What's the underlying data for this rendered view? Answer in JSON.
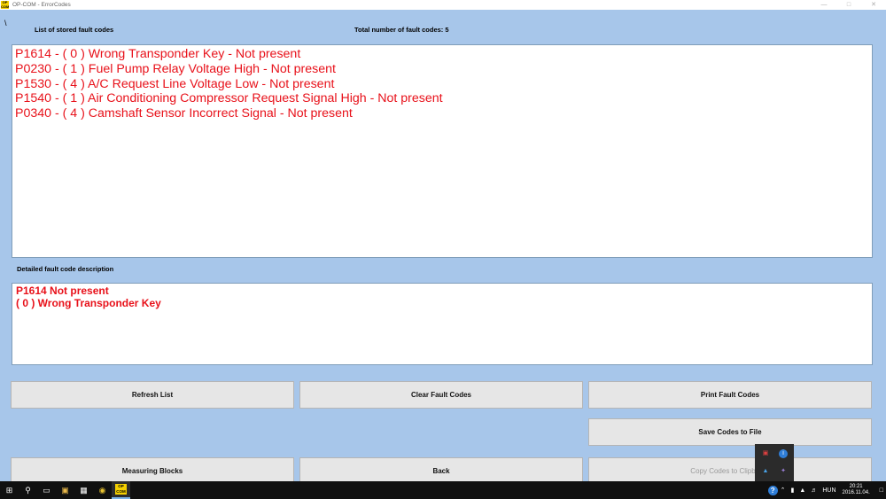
{
  "window": {
    "title": "OP-COM - ErrorCodes",
    "app_icon_text": "OP COM"
  },
  "header": {
    "backslash": "\\",
    "list_label": "List of stored fault codes",
    "total_label": "Total number of fault codes:  5"
  },
  "faults": [
    "P1614 - ( 0 )  Wrong Transponder Key - Not present",
    "P0230 - ( 1 )  Fuel Pump Relay Voltage High - Not present",
    "P1530 - ( 4 )  A/C Request Line Voltage Low - Not present",
    "P1540 - ( 1 )  Air Conditioning Compressor Request Signal High - Not present",
    "P0340 - ( 4 )  Camshaft Sensor Incorrect Signal - Not present"
  ],
  "detail": {
    "label": "Detailed fault code description",
    "line1": "P1614  Not present",
    "line2": "( 0 )  Wrong Transponder Key"
  },
  "buttons": {
    "refresh": "Refresh List",
    "clear": "Clear Fault Codes",
    "print": "Print Fault Codes",
    "save": "Save Codes to File",
    "measuring": "Measuring Blocks",
    "back": "Back",
    "copy": "Copy Codes to Clipboard"
  },
  "taskbar": {
    "language": "HUN",
    "time": "20:21",
    "date": "2016.11.04.",
    "opcom_icon_text": "OP COM"
  },
  "colors": {
    "fault_text": "#e8111a",
    "background": "#a7c6ea",
    "taskbar": "#101010"
  }
}
